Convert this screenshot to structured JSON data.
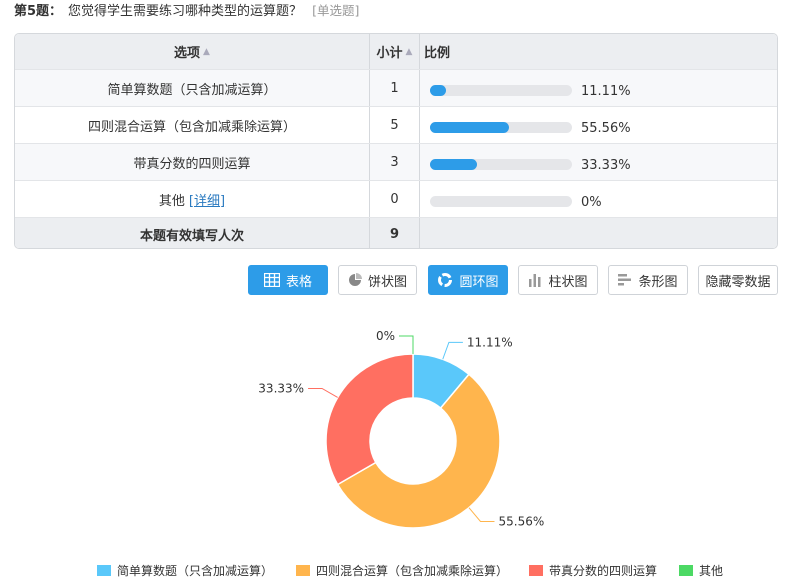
{
  "question": {
    "number_label": "第5题：",
    "text": "您觉得学生需要练习哪种类型的运算题？",
    "type_label": "[单选题]"
  },
  "table": {
    "headers": {
      "option": "选项",
      "count": "小计",
      "ratio": "比例"
    },
    "rows": [
      {
        "option": "简单算数题（只含加减运算）",
        "count": "1",
        "percent": "11.11%",
        "fill": 0.1111
      },
      {
        "option": "四则混合运算（包含加减乘除运算）",
        "count": "5",
        "percent": "55.56%",
        "fill": 0.5556
      },
      {
        "option": "带真分数的四则运算",
        "count": "3",
        "percent": "33.33%",
        "fill": 0.3333
      },
      {
        "option": "其他",
        "detail_link": "[详细]",
        "count": "0",
        "percent": "0%",
        "fill": 0
      }
    ],
    "footer": {
      "label": "本题有效填写人次",
      "total": "9"
    }
  },
  "toolbar": {
    "buttons": [
      {
        "label": "表格",
        "icon": "table-icon",
        "active": true
      },
      {
        "label": "饼状图",
        "icon": "pie-chart-icon",
        "active": false
      },
      {
        "label": "圆环图",
        "icon": "donut-chart-icon",
        "active": true
      },
      {
        "label": "柱状图",
        "icon": "bar-chart-icon",
        "active": false
      },
      {
        "label": "条形图",
        "icon": "horizontal-bar-icon",
        "active": false
      },
      {
        "label": "隐藏零数据",
        "icon": "",
        "active": false
      }
    ]
  },
  "chart_data": {
    "type": "pie",
    "variant": "donut",
    "categories": [
      "简单算数题（只含加减运算）",
      "四则混合运算（包含加减乘除运算）",
      "带真分数的四则运算",
      "其他"
    ],
    "values": [
      11.11,
      55.56,
      33.33,
      0
    ],
    "data_labels": [
      "11.11%",
      "55.56%",
      "33.33%",
      "0%"
    ],
    "colors": [
      "#5ac8fa",
      "#ffb54d",
      "#ff6f61",
      "#4cd964"
    ],
    "legend_position": "bottom"
  }
}
